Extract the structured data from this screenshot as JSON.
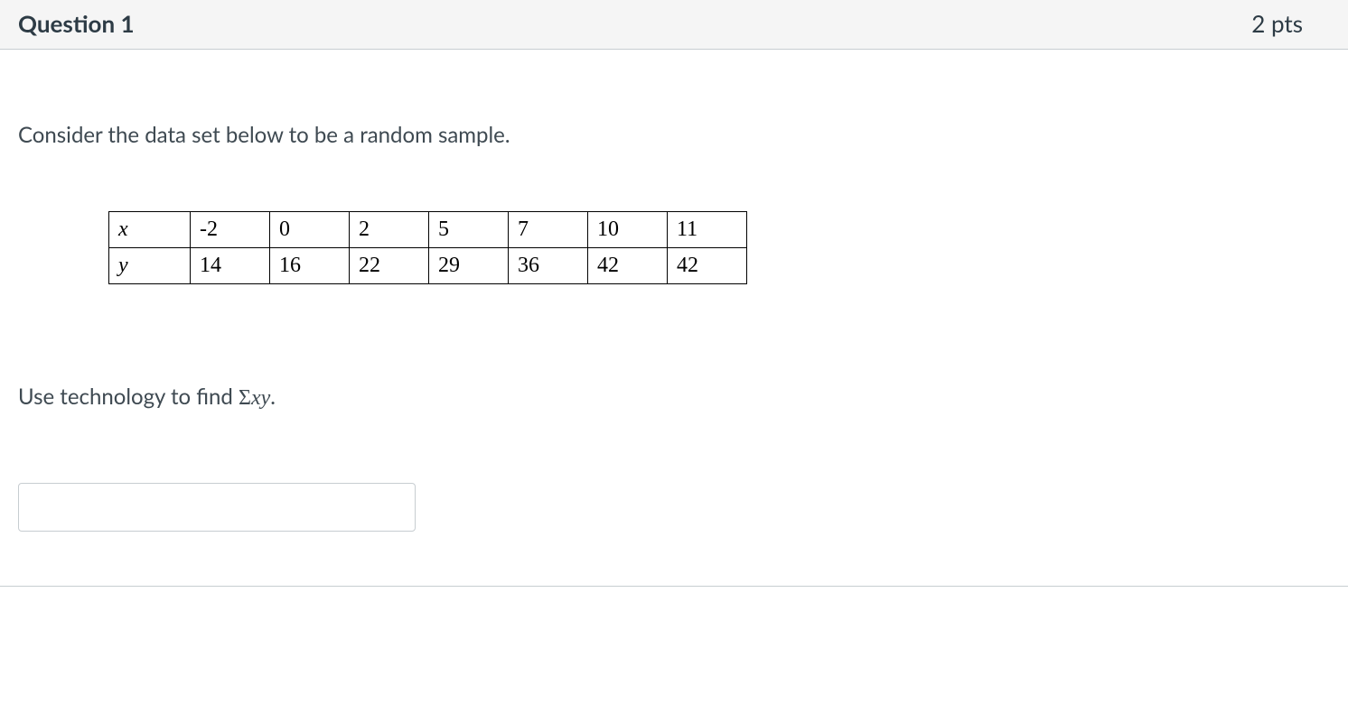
{
  "header": {
    "title": "Question 1",
    "points": "2 pts"
  },
  "prompt_intro": "Consider the data set below to be a random sample.",
  "table": {
    "rows": [
      {
        "label": "x",
        "cells": [
          "-2",
          "0",
          "2",
          "5",
          "7",
          "10",
          "11"
        ]
      },
      {
        "label": "y",
        "cells": [
          "14",
          "16",
          "22",
          "29",
          "36",
          "42",
          "42"
        ]
      }
    ]
  },
  "instruction_prefix": "Use technology to find ",
  "sigma": "Σ",
  "xy": "xy",
  "period": ".",
  "answer_value": ""
}
